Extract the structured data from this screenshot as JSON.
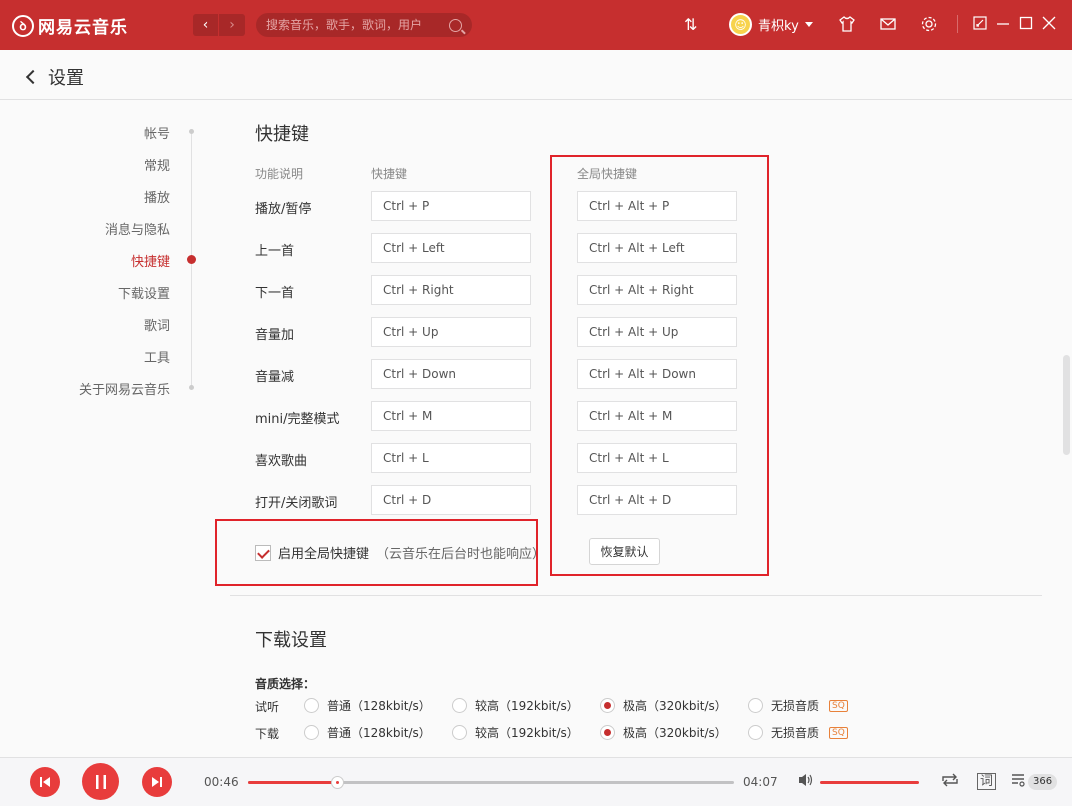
{
  "app": {
    "logo_text": "网易云音乐",
    "search_placeholder": "搜索音乐，歌手，歌词，用户",
    "username": "青枳ky"
  },
  "header": {
    "title": "设置"
  },
  "sidenav": [
    {
      "label": "帐号",
      "active": false
    },
    {
      "label": "常规",
      "active": false
    },
    {
      "label": "播放",
      "active": false
    },
    {
      "label": "消息与隐私",
      "active": false
    },
    {
      "label": "快捷键",
      "active": true
    },
    {
      "label": "下载设置",
      "active": false
    },
    {
      "label": "歌词",
      "active": false
    },
    {
      "label": "工具",
      "active": false
    },
    {
      "label": "关于网易云音乐",
      "active": false
    }
  ],
  "shortcuts": {
    "title": "快捷键",
    "col_function": "功能说明",
    "col_shortcut": "快捷键",
    "col_global": "全局快捷键",
    "rows": [
      {
        "label": "播放/暂停",
        "local": "Ctrl + P",
        "global": "Ctrl + Alt + P"
      },
      {
        "label": "上一首",
        "local": "Ctrl + Left",
        "global": "Ctrl + Alt + Left"
      },
      {
        "label": "下一首",
        "local": "Ctrl + Right",
        "global": "Ctrl + Alt + Right"
      },
      {
        "label": "音量加",
        "local": "Ctrl + Up",
        "global": "Ctrl + Alt + Up"
      },
      {
        "label": "音量减",
        "local": "Ctrl + Down",
        "global": "Ctrl + Alt + Down"
      },
      {
        "label": "mini/完整模式",
        "local": "Ctrl + M",
        "global": "Ctrl + Alt + M"
      },
      {
        "label": "喜欢歌曲",
        "local": "Ctrl + L",
        "global": "Ctrl + Alt + L"
      },
      {
        "label": "打开/关闭歌词",
        "local": "Ctrl + D",
        "global": "Ctrl + Alt + D"
      }
    ],
    "enable_global_label": "启用全局快捷键",
    "enable_global_hint": "（云音乐在后台时也能响应）",
    "enable_global_checked": true,
    "restore_label": "恢复默认"
  },
  "download": {
    "title": "下载设置",
    "quality_label": "音质选择：",
    "rows": [
      {
        "label": "试听",
        "options": [
          "普通（128kbit/s）",
          "较高（192kbit/s）",
          "极高（320kbit/s）",
          "无损音质"
        ],
        "selected": 2
      },
      {
        "label": "下载",
        "options": [
          "普通（128kbit/s）",
          "较高（192kbit/s）",
          "极高（320kbit/s）",
          "无损音质"
        ],
        "selected": 2
      }
    ],
    "lossless_badge": "SQ"
  },
  "player": {
    "elapsed": "00:46",
    "duration": "04:07",
    "progress_fraction": 0.186,
    "volume_fraction": 1.0,
    "lyrics_label": "词",
    "playlist_count": "366"
  },
  "colors": {
    "brand": "#c62f2f",
    "accent": "#e83c3c",
    "annotation": "#e0232a"
  }
}
